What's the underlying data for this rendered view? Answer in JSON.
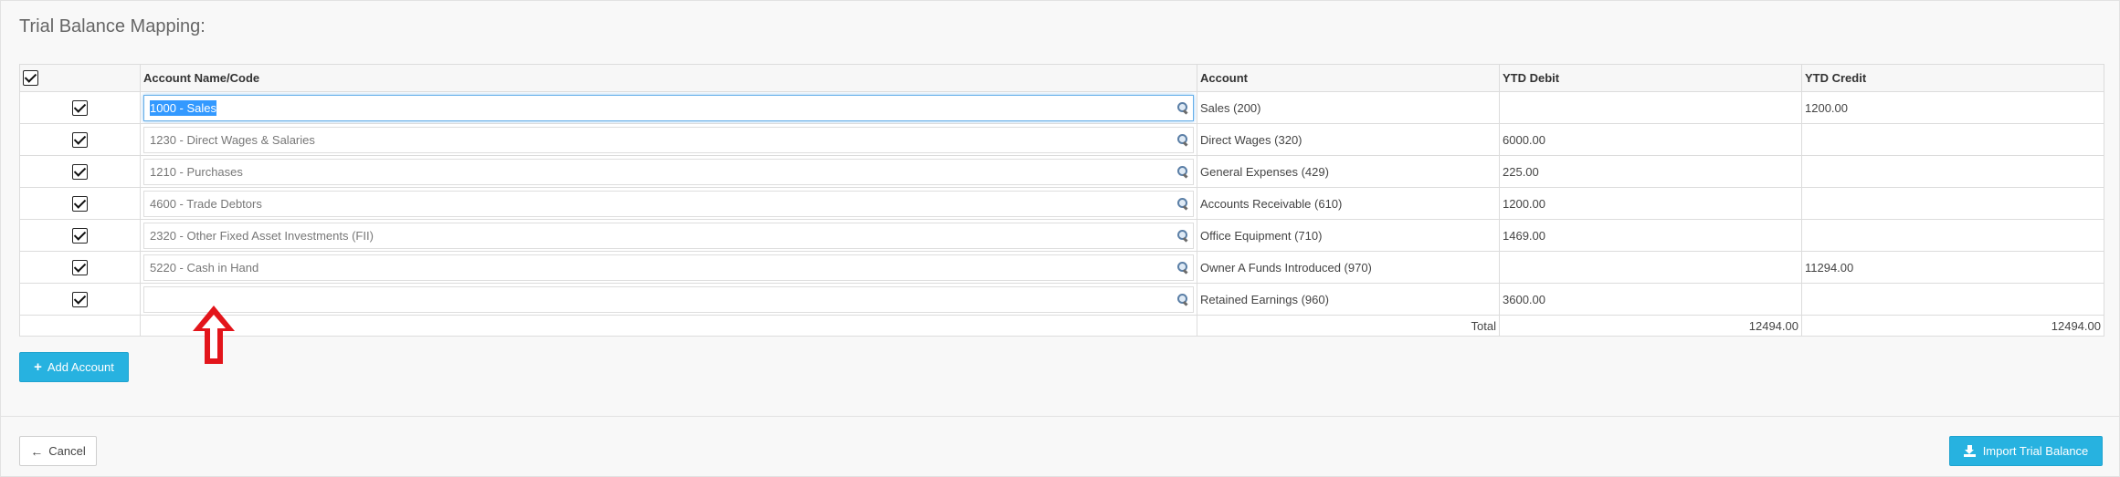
{
  "page": {
    "title": "Trial Balance Mapping:"
  },
  "table": {
    "headers": {
      "account_name_code": "Account Name/Code",
      "account": "Account",
      "ytd_debit": "YTD Debit",
      "ytd_credit": "YTD Credit"
    },
    "rows": [
      {
        "checked": true,
        "account_code": "1000 - Sales",
        "account": "Sales (200)",
        "ytd_debit": "",
        "ytd_credit": "1200.00"
      },
      {
        "checked": true,
        "account_code": "1230 - Direct Wages & Salaries",
        "account": "Direct Wages (320)",
        "ytd_debit": "6000.00",
        "ytd_credit": ""
      },
      {
        "checked": true,
        "account_code": "1210 - Purchases",
        "account": "General Expenses (429)",
        "ytd_debit": "225.00",
        "ytd_credit": ""
      },
      {
        "checked": true,
        "account_code": "4600 - Trade Debtors",
        "account": "Accounts Receivable (610)",
        "ytd_debit": "1200.00",
        "ytd_credit": ""
      },
      {
        "checked": true,
        "account_code": "2320 - Other Fixed Asset Investments (FII)",
        "account": "Office Equipment (710)",
        "ytd_debit": "1469.00",
        "ytd_credit": ""
      },
      {
        "checked": true,
        "account_code": "5220 - Cash in Hand",
        "account": "Owner A Funds Introduced (970)",
        "ytd_debit": "",
        "ytd_credit": "11294.00"
      },
      {
        "checked": true,
        "account_code": "",
        "account": "Retained Earnings (960)",
        "ytd_debit": "3600.00",
        "ytd_credit": ""
      }
    ],
    "total": {
      "label": "Total",
      "ytd_debit": "12494.00",
      "ytd_credit": "12494.00"
    }
  },
  "buttons": {
    "add_account": "Add Account",
    "cancel": "Cancel",
    "import_trial_balance": "Import Trial Balance"
  },
  "icons": {
    "search": "search-icon",
    "plus": "plus-icon",
    "back": "arrow-left-icon",
    "download": "download-icon",
    "annotation": "red-up-arrow-icon"
  },
  "colors": {
    "primary": "#27b2e0",
    "selection": "#3399ff",
    "annotation": "#e3151b"
  }
}
